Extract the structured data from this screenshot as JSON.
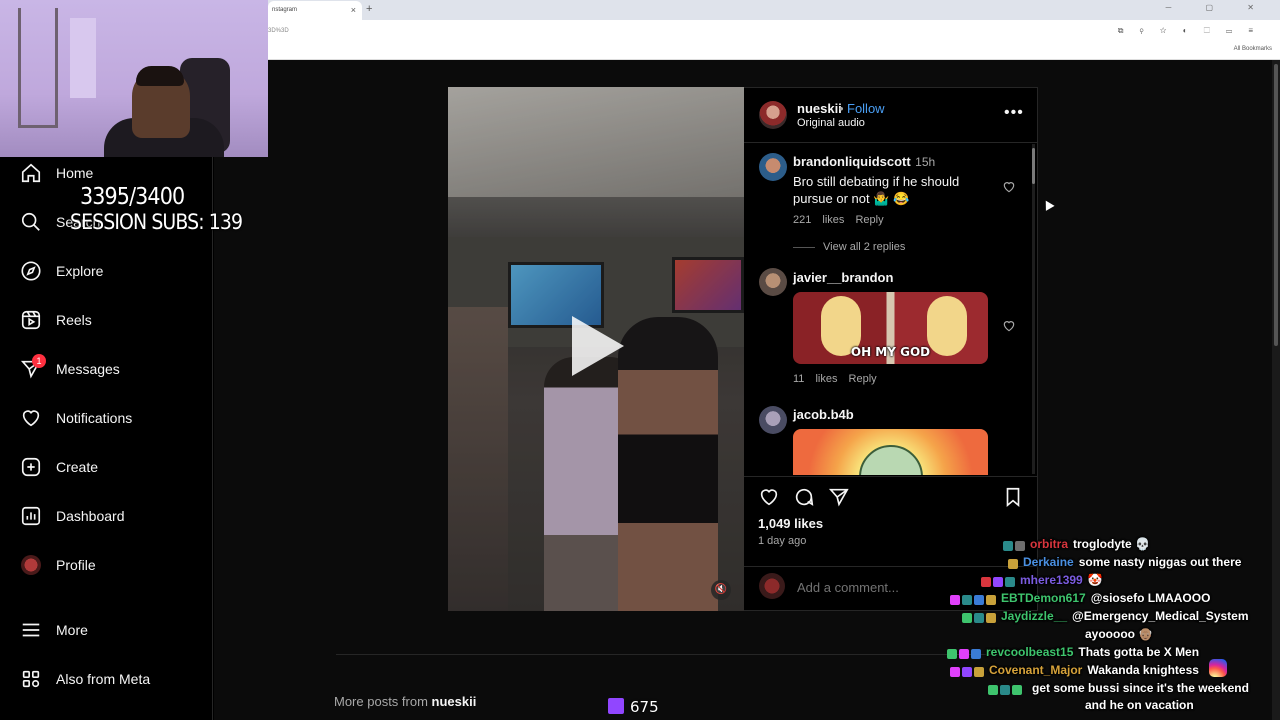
{
  "browser": {
    "tab_title": "nstagram",
    "tab_close": "×",
    "new_tab": "+",
    "url_fragment": "3D%3D",
    "bookmarks_label": "All Bookmarks",
    "window_controls": "─ ▢ ✕",
    "toolbar_icons": "⧉ ⚲ ☆ ◐ ⬚ ▭ ≡"
  },
  "overlay": {
    "sub_goal": "3395/3400",
    "session_subs": "SESSION SUBS: 139",
    "sub_count_bottom": "675"
  },
  "nav": {
    "items": [
      {
        "label": "Home",
        "icon": "home-icon"
      },
      {
        "label": "Search",
        "icon": "search-icon"
      },
      {
        "label": "Explore",
        "icon": "compass-icon"
      },
      {
        "label": "Reels",
        "icon": "reels-icon"
      },
      {
        "label": "Messages",
        "icon": "messenger-icon",
        "badge": "1"
      },
      {
        "label": "Notifications",
        "icon": "heart-icon"
      },
      {
        "label": "Create",
        "icon": "plus-square-icon"
      },
      {
        "label": "Dashboard",
        "icon": "chart-icon"
      },
      {
        "label": "Profile",
        "icon": "avatar-icon"
      },
      {
        "label": "More",
        "icon": "menu-icon"
      },
      {
        "label": "Also from Meta",
        "icon": "meta-icon"
      }
    ]
  },
  "post": {
    "author": "nueskii",
    "separator": "•",
    "follow_label": "Follow",
    "audio": "Original audio",
    "more_label": "•••",
    "likes": "1,049 likes",
    "time_ago": "1 day ago",
    "add_comment_placeholder": "Add a comment...",
    "more_posts_prefix": "More posts from",
    "more_posts_user": "nueskii",
    "mute_label": "🔇"
  },
  "comments": [
    {
      "user": "brandonliquidscott",
      "time": "15h",
      "text": "Bro still debating if he should pursue or not 🤷‍♂️ 😂",
      "meta": "221 likes Reply",
      "view_replies": "View all 2 replies"
    },
    {
      "user": "javier__brandon",
      "gif_text": "OH MY GOD",
      "meta": "11 likes Reply"
    },
    {
      "user": "jacob.b4b"
    }
  ],
  "chat": [
    {
      "user": "orbitra",
      "user_color": "#d9363e",
      "text": "troglodyte 💀",
      "badges": [
        "#2a8a8a",
        "#6e6e6e"
      ]
    },
    {
      "user": "Derkaine",
      "user_color": "#4a90e2",
      "text": "some nasty niggas out there",
      "badges": [
        "#c8a13a"
      ]
    },
    {
      "user": "mhere1399",
      "user_color": "#7b5ce0",
      "text": "🤡",
      "badges": [
        "#d9363e",
        "#9146ff",
        "#2a8a8a"
      ]
    },
    {
      "user": "EBTDemon617",
      "user_color": "#3ec46d",
      "text": "@siosefo LMAAOOO",
      "badges": [
        "#e040fb",
        "#2a8a8a",
        "#3a7bd5",
        "#c8a13a"
      ]
    },
    {
      "user": "Jaydizzle__",
      "user_color": "#3ec46d",
      "text": "@Emergency_Medical_System",
      "badges": [
        "#3ec46d",
        "#2a8a8a",
        "#c8a13a"
      ]
    },
    {
      "user": "",
      "user_color": "#ffffff",
      "text": "ayooooo 👴🏽",
      "badges": []
    },
    {
      "user": "revcoolbeast15",
      "user_color": "#3ec46d",
      "text": "Thats gotta be X Men",
      "badges": [
        "#3ec46d",
        "#e040fb",
        "#3a7bd5"
      ]
    },
    {
      "user": "Covenant_Major",
      "user_color": "#d6a23a",
      "text": "Wakanda knightess",
      "badges": [
        "#e040fb",
        "#9146ff",
        "#c8a13a"
      ]
    },
    {
      "user": "",
      "user_color": "#7b5ce0",
      "text": "get some bussi since it's the weekend",
      "badges": [
        "#3ec46d",
        "#2a8a8a",
        "#3ec46d"
      ]
    },
    {
      "user": "",
      "user_color": "#ffffff",
      "text": "and he on vacation",
      "badges": []
    }
  ]
}
